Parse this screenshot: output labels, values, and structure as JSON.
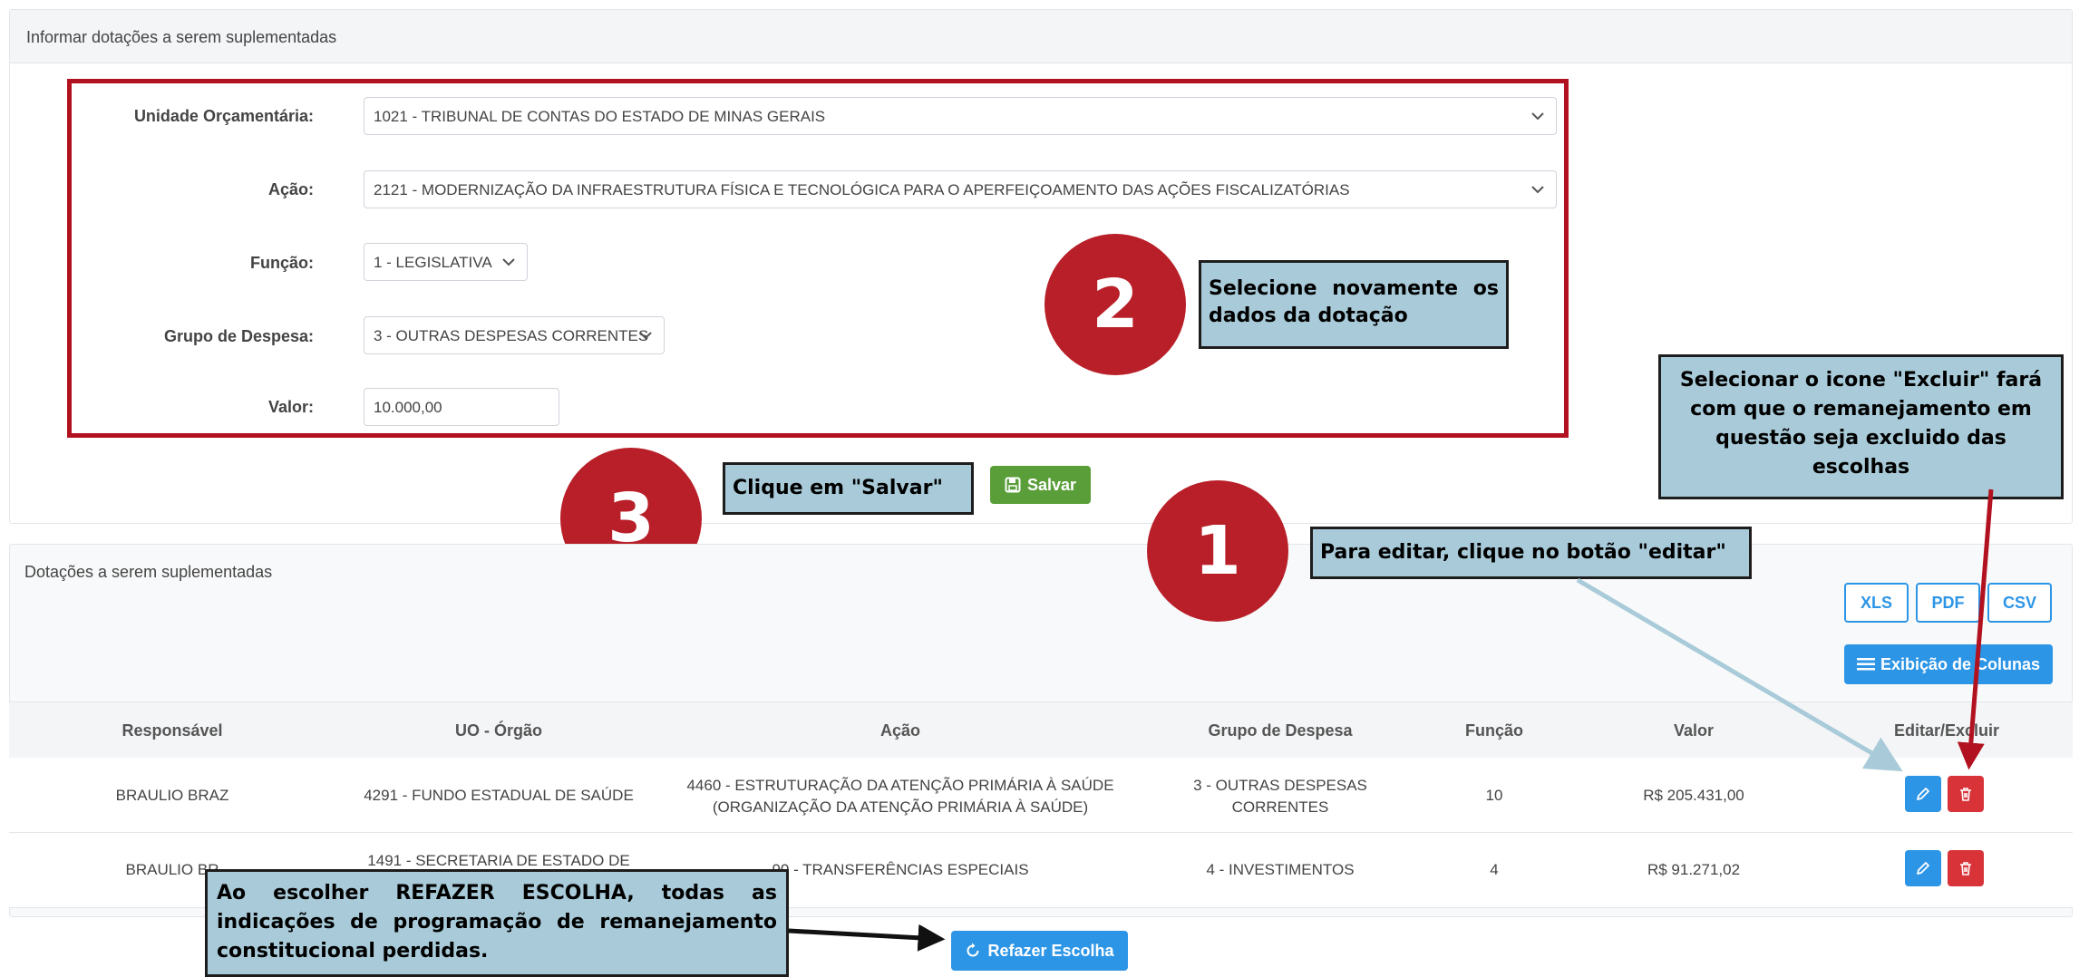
{
  "form_panel": {
    "title": "Informar dotações a serem suplementadas",
    "fields": {
      "unidade_label": "Unidade Orçamentária:",
      "unidade_value": "1021 - TRIBUNAL DE CONTAS DO ESTADO DE MINAS GERAIS",
      "acao_label": "Ação:",
      "acao_value": "2121 - MODERNIZAÇÃO DA INFRAESTRUTURA FÍSICA E TECNOLÓGICA PARA O APERFEIÇOAMENTO DAS AÇÕES FISCALIZATÓRIAS",
      "funcao_label": "Função:",
      "funcao_value": "1 - LEGISLATIVA",
      "grupo_label": "Grupo de Despesa:",
      "grupo_value": "3 - OUTRAS DESPESAS CORRENTES",
      "valor_label": "Valor:",
      "valor_value": "10.000,00"
    },
    "save_label": "Salvar"
  },
  "table_panel": {
    "title": "Dotações a serem suplementadas",
    "export_buttons": [
      "XLS",
      "PDF",
      "CSV"
    ],
    "columns_button": "Exibição de Colunas",
    "headers": [
      "Responsável",
      "UO - Órgão",
      "Ação",
      "Grupo de Despesa",
      "Função",
      "Valor",
      "Editar/Excluir"
    ],
    "rows": [
      {
        "responsavel": "BRAULIO BRAZ",
        "uo": "4291 - FUNDO ESTADUAL DE SAÚDE",
        "acao_line1": "4460 - ESTRUTURAÇÃO DA ATENÇÃO PRIMÁRIA À SAÚDE",
        "acao_line2": "(ORGANIZAÇÃO DA ATENÇÃO PRIMÁRIA À SAÚDE)",
        "grupo_line1": "3 - OUTRAS DESPESAS",
        "grupo_line2": "CORRENTES",
        "funcao": "10",
        "valor": "R$ 205.431,00"
      },
      {
        "responsavel": "BRAULIO BR",
        "uo": "1491 - SECRETARIA DE ESTADO DE",
        "acao": "90 - TRANSFERÊNCIAS ESPECIAIS",
        "grupo": "4 - INVESTIMENTOS",
        "funcao": "4",
        "valor": "R$ 91.271,02"
      }
    ],
    "redo_label": "Refazer Escolha"
  },
  "annotations": {
    "step1_number": "1",
    "step1_text": "Para editar, clique no botão \"editar\"",
    "step2_number": "2",
    "step2_text": "Selecione novamente os dados da dotação",
    "step3_number": "3",
    "step3_text": "Clique em \"Salvar\"",
    "excluir_text": "Selecionar o icone \"Excluir\" fará com que o remanejamento em questão seja excluido das escolhas",
    "refazer_text": "Ao escolher REFAZER ESCOLHA, todas as indicações de programação de remanejamento constitucional perdidas."
  },
  "colors": {
    "annotation_red": "#b81f28",
    "note_fill": "#a9cbd9",
    "save_green": "#5a9e3a",
    "primary_blue": "#2d95e6",
    "delete_red": "#d9333a"
  }
}
